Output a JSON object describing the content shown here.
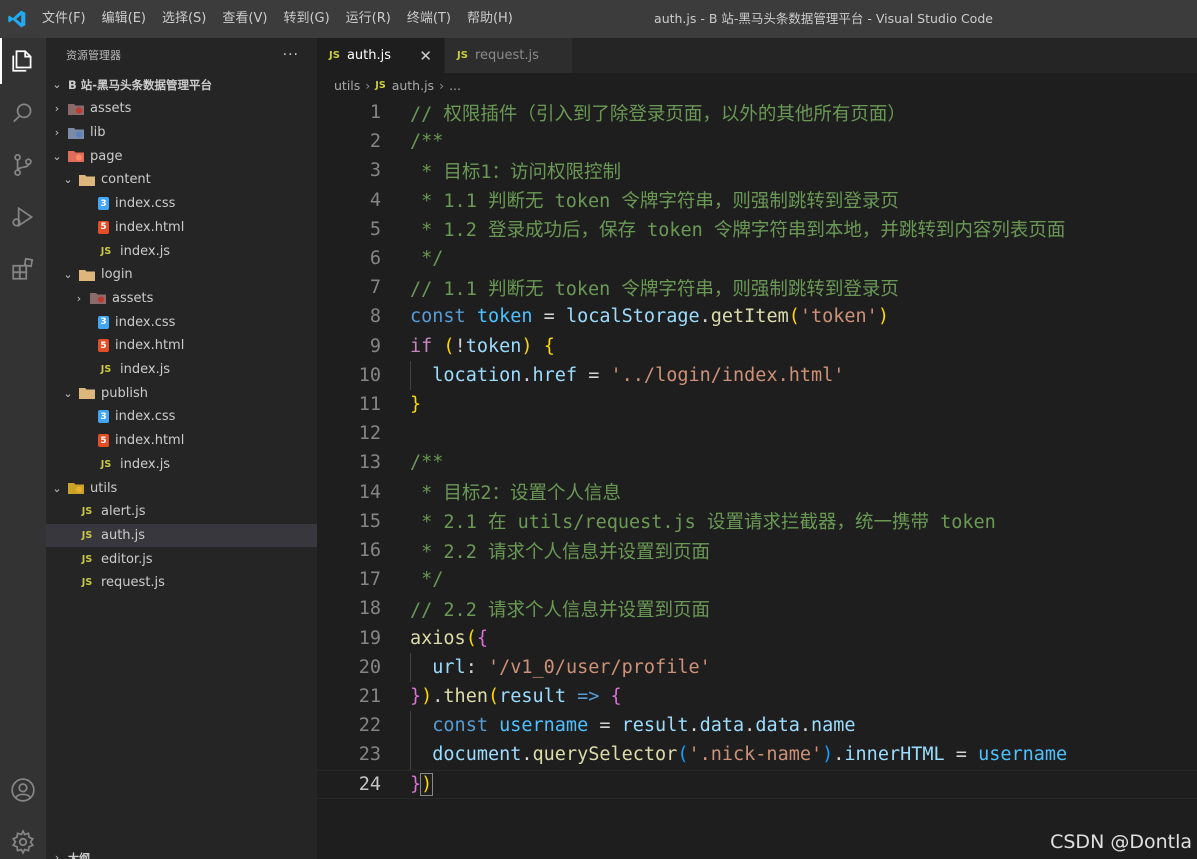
{
  "titlebar": {
    "menu": [
      "文件(F)",
      "编辑(E)",
      "选择(S)",
      "查看(V)",
      "转到(G)",
      "运行(R)",
      "终端(T)",
      "帮助(H)"
    ],
    "window_title": "auth.js - B 站-黑马头条数据管理平台 - Visual Studio Code"
  },
  "activitybar": {
    "icons": [
      "explorer-icon",
      "search-icon",
      "source-control-icon",
      "run-debug-icon",
      "extensions-icon",
      "account-icon",
      "settings-gear-icon"
    ]
  },
  "sidebar": {
    "header": "资源管理器",
    "more": "···",
    "root": "B 站-黑马头条数据管理平台",
    "tree": [
      {
        "label": "assets",
        "type": "folder-assets",
        "depth": 1,
        "chev": "›"
      },
      {
        "label": "lib",
        "type": "folder-lib",
        "depth": 1,
        "chev": "›"
      },
      {
        "label": "page",
        "type": "folder-page",
        "depth": 1,
        "chev": "⌄"
      },
      {
        "label": "content",
        "type": "folder",
        "depth": 2,
        "chev": "⌄"
      },
      {
        "label": "index.css",
        "type": "css",
        "depth": 3,
        "chev": ""
      },
      {
        "label": "index.html",
        "type": "html",
        "depth": 3,
        "chev": ""
      },
      {
        "label": "index.js",
        "type": "js",
        "depth": 3,
        "chev": ""
      },
      {
        "label": "login",
        "type": "folder",
        "depth": 2,
        "chev": "⌄"
      },
      {
        "label": "assets",
        "type": "folder-assets",
        "depth": 3,
        "chev": "›"
      },
      {
        "label": "index.css",
        "type": "css",
        "depth": 3,
        "chev": ""
      },
      {
        "label": "index.html",
        "type": "html",
        "depth": 3,
        "chev": ""
      },
      {
        "label": "index.js",
        "type": "js",
        "depth": 3,
        "chev": ""
      },
      {
        "label": "publish",
        "type": "folder",
        "depth": 2,
        "chev": "⌄"
      },
      {
        "label": "index.css",
        "type": "css",
        "depth": 3,
        "chev": ""
      },
      {
        "label": "index.html",
        "type": "html",
        "depth": 3,
        "chev": ""
      },
      {
        "label": "index.js",
        "type": "js",
        "depth": 3,
        "chev": ""
      },
      {
        "label": "utils",
        "type": "folder-utils",
        "depth": 1,
        "chev": "⌄"
      },
      {
        "label": "alert.js",
        "type": "js",
        "depth": 2,
        "chev": ""
      },
      {
        "label": "auth.js",
        "type": "js",
        "depth": 2,
        "chev": "",
        "selected": true
      },
      {
        "label": "editor.js",
        "type": "js",
        "depth": 2,
        "chev": ""
      },
      {
        "label": "request.js",
        "type": "js",
        "depth": 2,
        "chev": ""
      }
    ],
    "outline": "大纲"
  },
  "tabs": [
    {
      "label": "auth.js",
      "icon": "JS",
      "active": true,
      "close": "✕"
    },
    {
      "label": "request.js",
      "icon": "JS",
      "active": false
    }
  ],
  "breadcrumb": {
    "folder": "utils",
    "file": "auth.js",
    "more": "...",
    "sep": "›",
    "icon": "JS"
  },
  "editor": {
    "current_line": 24,
    "lines": [
      [
        [
          "c-cmt",
          "// 权限插件（引入到了除登录页面，以外的其他所有页面）"
        ]
      ],
      [
        [
          "c-cmt",
          "/**"
        ]
      ],
      [
        [
          "c-cmt",
          " * 目标1：访问权限控制"
        ]
      ],
      [
        [
          "c-cmt",
          " * 1.1 判断无 token 令牌字符串，则强制跳转到登录页"
        ]
      ],
      [
        [
          "c-cmt",
          " * 1.2 登录成功后，保存 token 令牌字符串到本地，并跳转到内容列表页面"
        ]
      ],
      [
        [
          "c-cmt",
          " */"
        ]
      ],
      [
        [
          "c-cmt",
          "// 1.1 判断无 token 令牌字符串，则强制跳转到登录页"
        ]
      ],
      [
        [
          "c-kw",
          "const "
        ],
        [
          "c-var",
          "token"
        ],
        [
          "",
          " = "
        ],
        [
          "c-prop",
          "localStorage"
        ],
        [
          "",
          "."
        ],
        [
          "c-fn",
          "getItem"
        ],
        [
          "c-br1",
          "("
        ],
        [
          "c-str",
          "'token'"
        ],
        [
          "c-br1",
          ")"
        ]
      ],
      [
        [
          "c-ctl",
          "if "
        ],
        [
          "c-br1",
          "("
        ],
        [
          "",
          "!"
        ],
        [
          "c-prop",
          "token"
        ],
        [
          "c-br1",
          ")"
        ],
        [
          "",
          " "
        ],
        [
          "c-br1",
          "{"
        ]
      ],
      [
        [
          "",
          "  "
        ],
        [
          "c-prop",
          "location"
        ],
        [
          "",
          "."
        ],
        [
          "c-prop",
          "href"
        ],
        [
          "",
          " = "
        ],
        [
          "c-str",
          "'../login/index.html'"
        ]
      ],
      [
        [
          "c-br1",
          "}"
        ]
      ],
      [
        [
          "",
          ""
        ]
      ],
      [
        [
          "c-cmt",
          "/**"
        ]
      ],
      [
        [
          "c-cmt",
          " * 目标2：设置个人信息"
        ]
      ],
      [
        [
          "c-cmt",
          " * 2.1 在 utils/request.js 设置请求拦截器，统一携带 token"
        ]
      ],
      [
        [
          "c-cmt",
          " * 2.2 请求个人信息并设置到页面"
        ]
      ],
      [
        [
          "c-cmt",
          " */"
        ]
      ],
      [
        [
          "c-cmt",
          "// 2.2 请求个人信息并设置到页面"
        ]
      ],
      [
        [
          "c-fn",
          "axios"
        ],
        [
          "c-br1",
          "("
        ],
        [
          "c-br2",
          "{"
        ]
      ],
      [
        [
          "",
          "  "
        ],
        [
          "c-prop",
          "url"
        ],
        [
          "",
          ": "
        ],
        [
          "c-str",
          "'/v1_0/user/profile'"
        ]
      ],
      [
        [
          "c-br2",
          "}"
        ],
        [
          "c-br1",
          ")"
        ],
        [
          "",
          "."
        ],
        [
          "c-fn",
          "then"
        ],
        [
          "c-br1",
          "("
        ],
        [
          "c-prop",
          "result"
        ],
        [
          "",
          " "
        ],
        [
          "c-kw",
          "=>"
        ],
        [
          "",
          " "
        ],
        [
          "c-br2",
          "{"
        ]
      ],
      [
        [
          "",
          "  "
        ],
        [
          "c-kw",
          "const "
        ],
        [
          "c-var",
          "username"
        ],
        [
          "",
          " = "
        ],
        [
          "c-prop",
          "result"
        ],
        [
          "",
          "."
        ],
        [
          "c-prop",
          "data"
        ],
        [
          "",
          "."
        ],
        [
          "c-prop",
          "data"
        ],
        [
          "",
          "."
        ],
        [
          "c-prop",
          "name"
        ]
      ],
      [
        [
          "",
          "  "
        ],
        [
          "c-prop",
          "document"
        ],
        [
          "",
          "."
        ],
        [
          "c-fn",
          "querySelector"
        ],
        [
          "c-br3",
          "("
        ],
        [
          "c-str",
          "'.nick-name'"
        ],
        [
          "c-br3",
          ")"
        ],
        [
          "",
          "."
        ],
        [
          "c-prop",
          "innerHTML"
        ],
        [
          "",
          " = "
        ],
        [
          "c-var",
          "username"
        ]
      ],
      [
        [
          "c-br2",
          "}"
        ],
        [
          "c-br1",
          ")"
        ]
      ]
    ]
  },
  "watermark": "CSDN @Dontla",
  "colors": {
    "accent": "#007acc",
    "background": "#1e1e1e",
    "sidebar": "#252526",
    "activitybar": "#333333",
    "titlebar": "#3c3c3c"
  }
}
